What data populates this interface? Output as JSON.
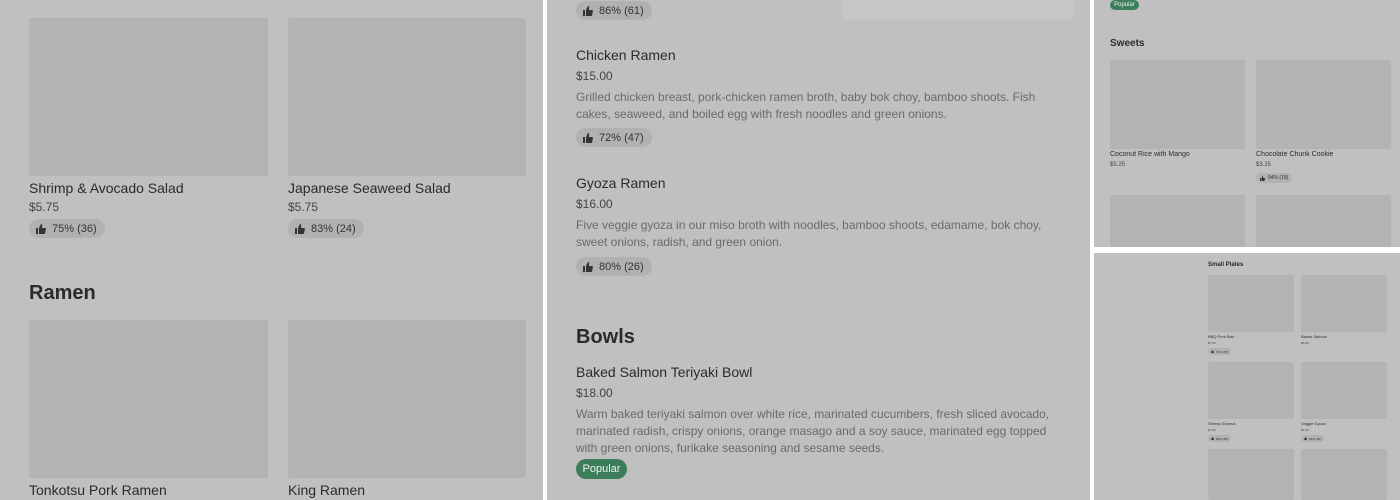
{
  "panel1": {
    "items": [
      {
        "name": "Shrimp & Avocado Salad",
        "price": "$5.75",
        "rating": "75% (36)"
      },
      {
        "name": "Japanese Seaweed Salad",
        "price": "$5.75",
        "rating": "83% (24)"
      }
    ],
    "section_title": "Ramen",
    "ramen_items": [
      {
        "name": "Tonkotsu Pork Ramen"
      },
      {
        "name": "King Ramen"
      }
    ]
  },
  "panel2": {
    "top_rating": "86% (61)",
    "items": [
      {
        "name": "Chicken Ramen",
        "price": "$15.00",
        "desc_line1": "Grilled chicken breast, pork-chicken ramen broth, baby bok choy, bamboo shoots. Fish",
        "desc_line2": "cakes, seaweed, and boiled egg with fresh noodles and green onions.",
        "rating": "72% (47)"
      },
      {
        "name": "Gyoza Ramen",
        "price": "$16.00",
        "desc_line1": "Five veggie gyoza in our miso broth with noodles, bamboo shoots, edamame, bok choy,",
        "desc_line2": "sweet onions, radish, and green onion.",
        "rating": "80% (26)"
      }
    ],
    "section_title": "Bowls",
    "bowl_item": {
      "name": "Baked Salmon Teriyaki Bowl",
      "price": "$18.00",
      "desc_line1": "Warm baked teriyaki salmon over white rice, marinated cucumbers, fresh sliced avocado,",
      "desc_line2": "marinated radish, crispy onions, orange masago and a soy sauce, marinated egg topped",
      "desc_line3": "with green onions, furikake seasoning and sesame seeds.",
      "badge": "Popular"
    }
  },
  "panel3": {
    "top_badge": "Popular",
    "section_title": "Sweets",
    "items": [
      {
        "name": "Coconut Rice with Mango",
        "price": "$5.25"
      },
      {
        "name": "Chocolate Chunk Cookie",
        "price": "$3.25",
        "rating": "94% (18)"
      }
    ]
  },
  "panel4": {
    "section_title": "Small Plates",
    "items": [
      {
        "name": "BBQ Pork Bao",
        "price": "$7.50",
        "rating": "73% (78)"
      },
      {
        "name": "Baked Salmon",
        "price": "$8.50"
      },
      {
        "name": "Shrimp Shumai",
        "price": "$7.00",
        "rating": "86% (65)"
      },
      {
        "name": "Veggie Gyoza",
        "price": "$6.00",
        "rating": "83% (45)"
      }
    ]
  },
  "colors": {
    "background": "#c0c0c0",
    "image_placeholder": "#b3b3b3",
    "popular_badge": "#3c7e5b",
    "rating_pill": "#b1b1b1"
  },
  "icons": [
    "thumbs-up-icon"
  ]
}
